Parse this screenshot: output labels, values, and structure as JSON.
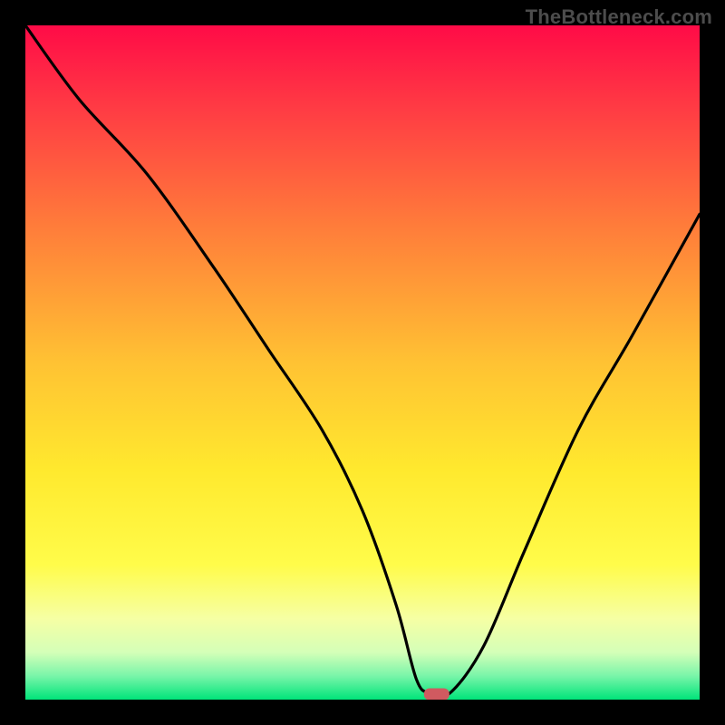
{
  "watermark": "TheBottleneck.com",
  "chart_data": {
    "type": "line",
    "title": "",
    "xlabel": "",
    "ylabel": "",
    "xlim": [
      0,
      100
    ],
    "ylim": [
      0,
      100
    ],
    "legend": false,
    "grid": false,
    "series": [
      {
        "name": "bottleneck-curve",
        "x": [
          0,
          8,
          18,
          28,
          36,
          44,
          50,
          55,
          58,
          60,
          63,
          68,
          74,
          82,
          90,
          100
        ],
        "y": [
          100,
          89,
          78,
          64,
          52,
          40,
          28,
          14,
          3,
          1,
          1,
          8,
          22,
          40,
          54,
          72
        ],
        "note": "y = bottleneck percentage (V-shaped curve); minimum near x≈61"
      }
    ],
    "marker": {
      "name": "optimal-point",
      "x": 61,
      "y": 0.8,
      "color": "#d05a60",
      "shape": "rounded-rect"
    },
    "background": {
      "type": "vertical-gradient",
      "stops": [
        {
          "pos": 0.0,
          "color": "#ff0b47"
        },
        {
          "pos": 0.12,
          "color": "#ff3a44"
        },
        {
          "pos": 0.3,
          "color": "#ff7d3a"
        },
        {
          "pos": 0.5,
          "color": "#ffc233"
        },
        {
          "pos": 0.66,
          "color": "#ffe92e"
        },
        {
          "pos": 0.8,
          "color": "#fffc4a"
        },
        {
          "pos": 0.88,
          "color": "#f6ffa4"
        },
        {
          "pos": 0.93,
          "color": "#d4ffb8"
        },
        {
          "pos": 0.965,
          "color": "#79f5a9"
        },
        {
          "pos": 1.0,
          "color": "#00e47a"
        }
      ]
    }
  }
}
